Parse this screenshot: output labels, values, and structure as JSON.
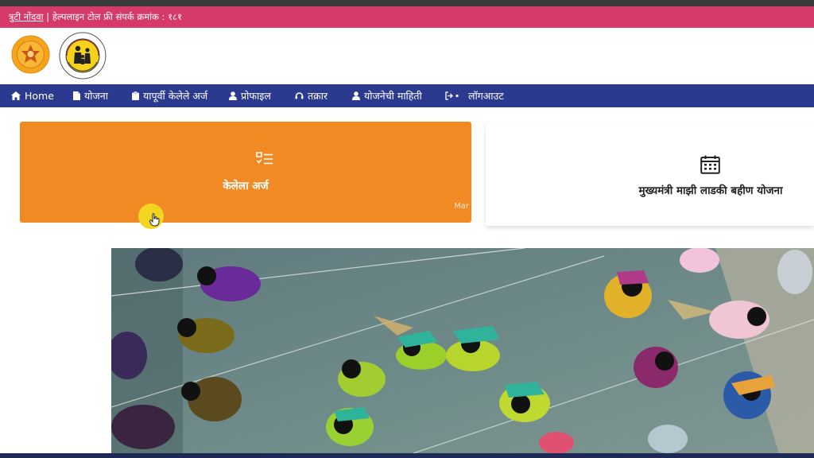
{
  "alert": {
    "link_text": "त्रुटी नोंदवा",
    "separator": "|",
    "helpline_text": "हेल्पलाइन टोल फ्री संपर्क क्रमांक : १८१"
  },
  "logos": [
    {
      "name": "maharashtra-govt-emblem"
    },
    {
      "name": "women-child-development-logo"
    }
  ],
  "nav": {
    "items": [
      {
        "label": "Home",
        "icon": "home-icon"
      },
      {
        "label": "योजना",
        "icon": "file-icon"
      },
      {
        "label": "यापूर्वी केलेले अर्ज",
        "icon": "clipboard-icon"
      },
      {
        "label": "प्रोफाइल",
        "icon": "user-icon"
      },
      {
        "label": "तक्रार",
        "icon": "headset-icon"
      },
      {
        "label": "योजनेची माहिती",
        "icon": "user-icon"
      },
      {
        "label": "लॉगआउट",
        "icon": "logout-icon"
      }
    ]
  },
  "cards": {
    "applications": {
      "label": "केलेला अर्ज",
      "corner_text": "Mar",
      "icon": "checklist-icon"
    },
    "scheme": {
      "label": "मुख्यमंत्री माझी लाडकी बहीण योजना",
      "icon": "calendar-icon"
    }
  },
  "colors": {
    "alert_bar": "#d63a6b",
    "nav_bar": "#2b3a8f",
    "card_orange": "#f28a24",
    "cursor_highlight": "#f2d51f"
  }
}
